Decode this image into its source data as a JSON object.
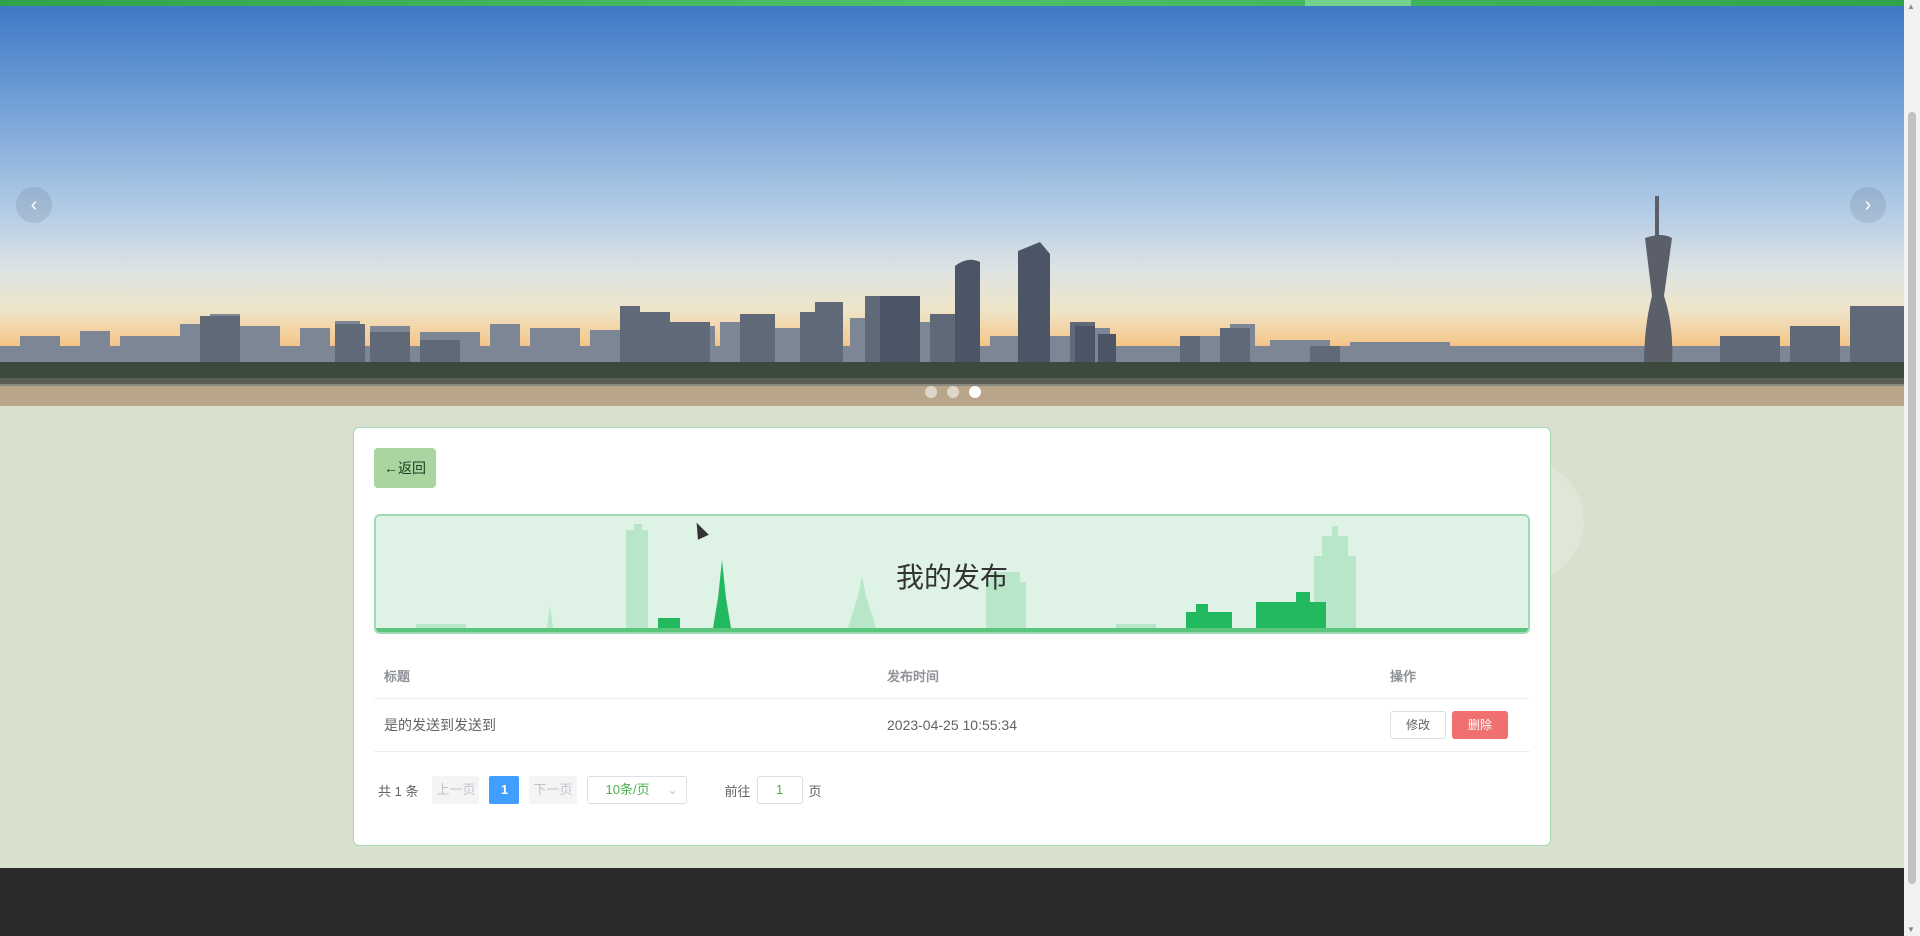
{
  "banner": {
    "prev_icon": "‹",
    "next_icon": "›",
    "slides": 3,
    "active_slide": 3
  },
  "card": {
    "back_label": "←返回",
    "title": "我的发布",
    "table": {
      "headers": [
        "标题",
        "发布时间",
        "操作"
      ],
      "rows": [
        {
          "title": "是的发送到发送到",
          "time": "2023-04-25 10:55:34",
          "edit": "修改",
          "delete": "删除"
        }
      ]
    },
    "pagination": {
      "total": "共 1 条",
      "prev": "上一页",
      "current": "1",
      "next": "下一页",
      "page_size": "10条/页",
      "goto_prefix": "前往",
      "goto_value": "1",
      "goto_suffix": "页"
    }
  },
  "colors": {
    "accent_green": "#4caf50",
    "danger": "#f07070",
    "primary": "#409eff"
  }
}
